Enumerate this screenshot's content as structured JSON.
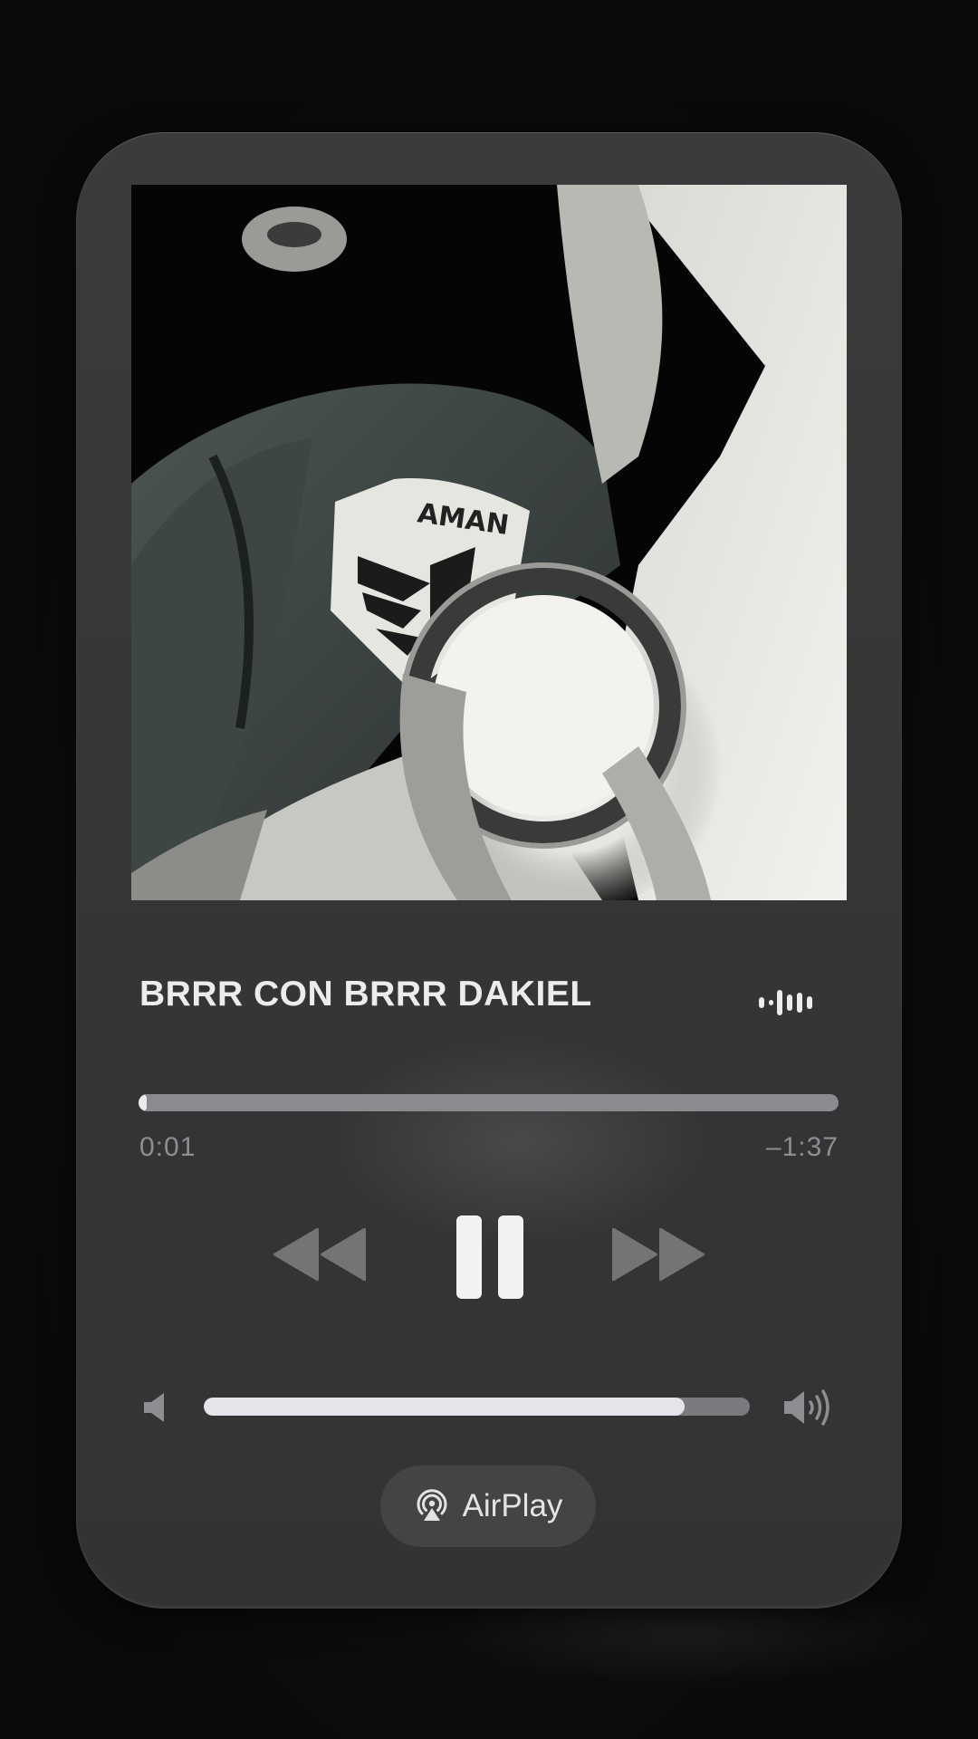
{
  "now_playing": {
    "title": "BRRR CON BRRR DAKIEL",
    "artwork_icon": "album-artwork-image",
    "artwork_badge_text": "AMAN"
  },
  "progress": {
    "elapsed": "0:01",
    "remaining": "–1:37",
    "fraction": 0.01
  },
  "controls": {
    "rewind_icon": "rewind-icon",
    "pause_icon": "pause-icon",
    "forward_icon": "fast-forward-icon"
  },
  "volume": {
    "level": 0.88,
    "low_icon": "speaker-low-icon",
    "high_icon": "speaker-high-icon"
  },
  "airplay": {
    "label": "AirPlay",
    "icon": "airplay-icon"
  },
  "colors": {
    "card": "#38383a",
    "primary_text": "#ececec",
    "secondary_text": "#8e8e92",
    "track": "#8b8b8f"
  }
}
